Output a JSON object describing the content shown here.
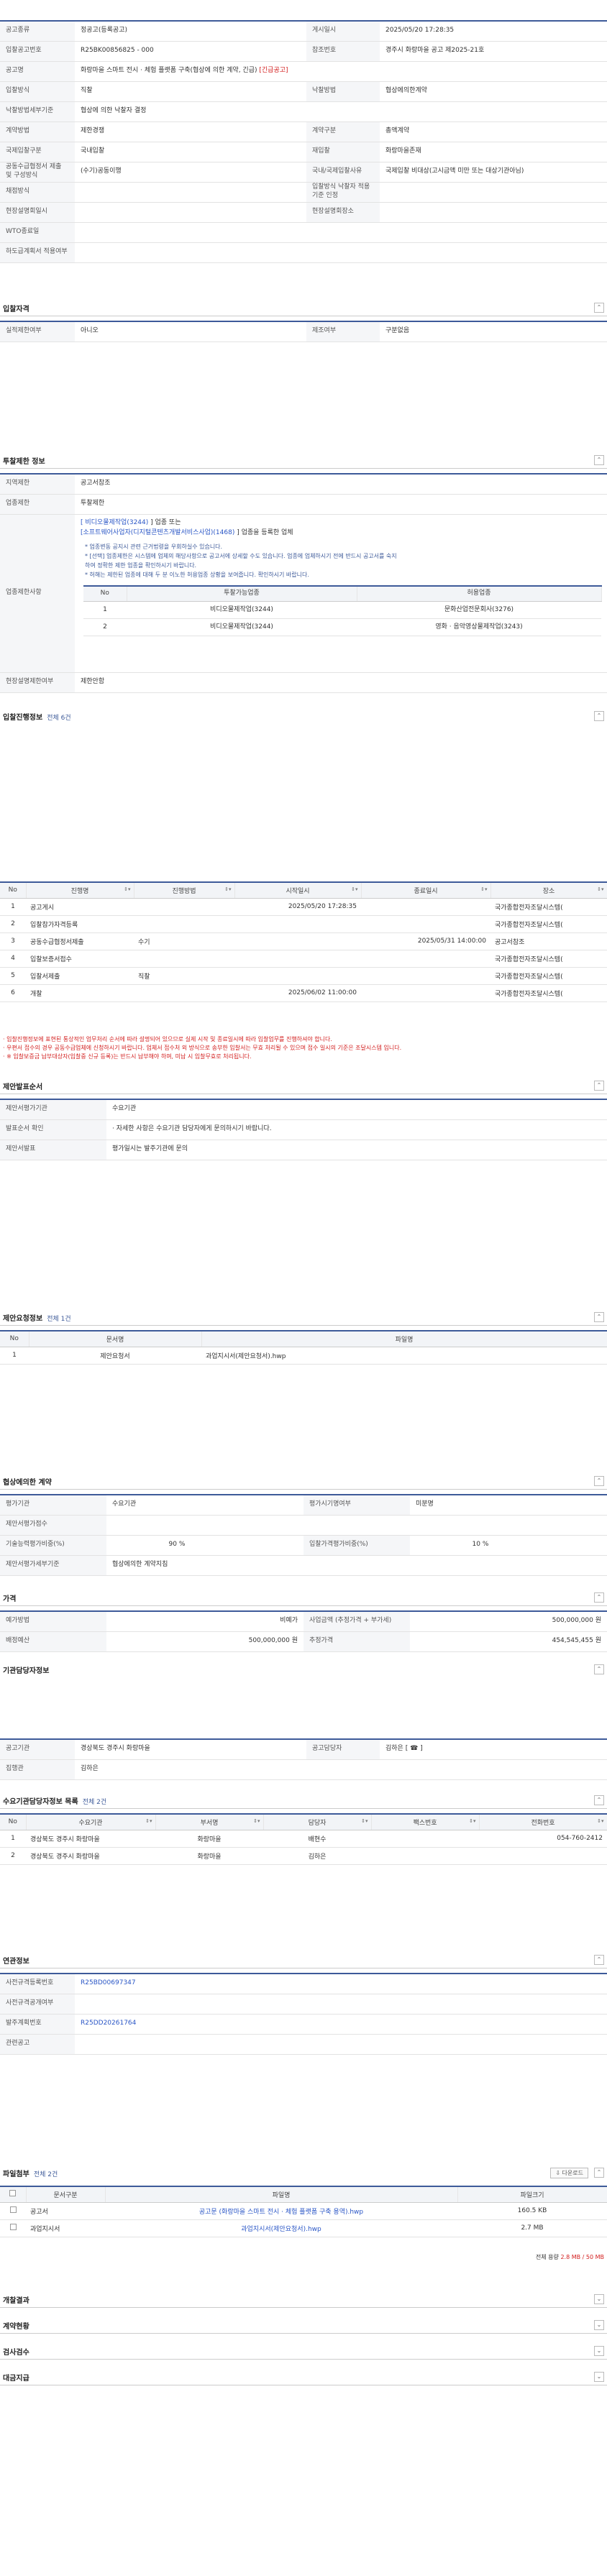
{
  "announcement": {
    "rows": [
      [
        {
          "l": "공고종류",
          "v": "정공고(등록공고)"
        },
        {
          "l": "게시일시",
          "v": "2025/05/20 17:28:35"
        }
      ],
      [
        {
          "l": "입찰공고번호",
          "v": "R25BK00856825 - 000"
        },
        {
          "l": "참조번호",
          "v": "경주시 화랑마을 공고 제2025-21호"
        }
      ],
      [
        {
          "l": "공고명",
          "v": "화랑마을 스마트 전시 · 체험 플랫폼 구축(협상에 의한 계약, 긴급)",
          "badge": "[긴급공고]"
        }
      ],
      [
        {
          "l": "입찰방식",
          "v": "직찰"
        },
        {
          "l": "낙찰방법",
          "v": "협상에의한계약"
        }
      ],
      [
        {
          "l": "낙찰방법세부기준",
          "v": "협상에 의한 낙찰자 결정"
        }
      ],
      [
        {
          "l": "계약방법",
          "v": "제한경쟁"
        },
        {
          "l": "계약구분",
          "v": "총액계약"
        }
      ],
      [
        {
          "l": "국제입찰구분",
          "v": "국내입찰"
        },
        {
          "l": "재입찰",
          "v": "화랑마을존재"
        }
      ],
      [
        {
          "l": "공동수급협정서 제출 및 구성방식",
          "v": "(수기)공동이행"
        },
        {
          "l": "국내/국제입찰사유",
          "v": "국제입찰 비대상(고시금액 미만 또는 대상기관아님)"
        }
      ],
      [
        {
          "l": "채점방식",
          "v": ""
        },
        {
          "l": "입찰방식 낙찰자 적용기준 인정",
          "v": ""
        }
      ],
      [
        {
          "l": "현장설명회일시",
          "v": ""
        },
        {
          "l": "현장설명회장소",
          "v": ""
        }
      ],
      [
        {
          "l": "WTO종료일",
          "v": ""
        }
      ],
      [
        {
          "l": "하도급계획서 적용여부",
          "v": ""
        }
      ]
    ]
  },
  "qualification": {
    "title": "입찰자격",
    "rows": [
      [
        {
          "l": "실적제한여부",
          "v": "아니오"
        },
        {
          "l": "제조여부",
          "v": "구분없음"
        }
      ]
    ]
  },
  "restriction": {
    "title": "투찰제한 정보",
    "region_label": "지역제한",
    "region_value": "공고서참조",
    "bid_label": "업종제한",
    "bid_value": "투찰제한",
    "cond_label": "업종제한사항",
    "cond_line1_a": "[ 비디오물제작업(3244)",
    "cond_line1_b": "] 업종 또는",
    "cond_line2_a": "[소프트웨어사업자(디지털콘텐츠개발서비스사업)(1468)",
    "cond_line2_b": "] 업종을 등록한 업체",
    "notes": [
      "* 업종변동 공지시 관련 근거법령을 우회하실수 있습니다.",
      "* [선택] 업종제한은 시스템에 업체의 해당사항으로 공고서에 상세할 수도 있습니다. 업종에 업체하시기 전에 반드시 공고서를 숙지",
      "  하여 정확한 제한 업종을 확인하시기 바랍니다.",
      "* 허해는 제한된 업종에 대해 두 분 이노한 허용업종 상황을 보여줍니다. 확인하시기 바랍니다."
    ],
    "table": {
      "headers": [
        "No",
        "투찰가능업종",
        "허용업종"
      ],
      "rows": [
        [
          "1",
          "비디오물제작업(3244)",
          "문화산업전문회사(3276)"
        ],
        [
          "2",
          "비디오물제작업(3244)",
          "영화 · 음악영상물제작업(3243)"
        ]
      ]
    },
    "perm_label": "현장설명제한여부",
    "perm_value": "제한안함"
  },
  "progress": {
    "title": "입찰진행정보",
    "count": "전체 6건",
    "headers": [
      "No",
      "진행명",
      "진행방법",
      "시작일시",
      "종료일시",
      "장소"
    ],
    "rows": [
      [
        "1",
        "공고게시",
        "",
        "2025/05/20 17:28:35",
        "",
        "국가종합전자조달시스템("
      ],
      [
        "2",
        "입찰참가자격등록",
        "",
        "",
        "",
        "국가종합전자조달시스템("
      ],
      [
        "3",
        "공동수급협정서제출",
        "수기",
        "",
        "2025/05/31 14:00:00",
        "공고서참조"
      ],
      [
        "4",
        "입찰보증서접수",
        "",
        "",
        "",
        "국가종합전자조달시스템("
      ],
      [
        "5",
        "입찰서제출",
        "직찰",
        "",
        "",
        "국가종합전자조달시스템("
      ],
      [
        "6",
        "개찰",
        "",
        "2025/06/02 11:00:00",
        "",
        "국가종합전자조달시스템("
      ]
    ],
    "notes": [
      "· 입찰진행정보에 표현된 통상적인 업무처리 순서에 따라 설명되어 있으므로 실제 시작 및 종료일시에 따라 입찰업무를 진행하셔야 합니다.",
      "· 우편서 접수의 경우 공동수급업체에 신청하시기 바랍니다. 업체서 접수처 외 방식으로 송부한 입찰서는 무효 처리될 수 있으며 접수 일시의 기준은 조달시스템 입니다.",
      "· ※ 입찰보증금 납부대상자(입찰중 신규 등록)는 반드시 납부해야 하며, 미납 시 입찰무효로 처리됩니다."
    ]
  },
  "proposal": {
    "title": "제안발표순서",
    "rows": [
      [
        {
          "l": "제안서평가기관",
          "v": "수요기관"
        }
      ],
      [
        {
          "l": "발표순서 확인",
          "v": "· 자세한 사항은 수요기관 담당자에게 문의하시기 바랍니다."
        }
      ],
      [
        {
          "l": "제안서발표",
          "v": "평가일시는 발주기관에 문의"
        }
      ]
    ]
  },
  "docs_req": {
    "title": "제안요청정보",
    "count": "전체 1건",
    "headers": [
      "No",
      "문서명",
      "파일명"
    ],
    "rows": [
      [
        "1",
        "제안요청서",
        "과업지시서(제안요청서).hwp"
      ]
    ]
  },
  "negotiation": {
    "title": "협상에의한 계약",
    "rows": [
      [
        {
          "l": "평가기관",
          "v": "수요기관"
        },
        {
          "l": "평가시기명여부",
          "v": "미분명"
        }
      ],
      [
        {
          "l": "제안서평가점수",
          "v": ""
        }
      ],
      [
        {
          "l": "기술능력평가비중(%)",
          "v": "90",
          "unit": "%"
        },
        {
          "l": "입찰가격평가비중(%)",
          "v": "10",
          "unit": "%"
        }
      ],
      [
        {
          "l": "제안서평가세부기준",
          "v": "협상에의한 계약지침"
        }
      ]
    ]
  },
  "price": {
    "title": "가격",
    "rows": [
      [
        {
          "l": "예가방법",
          "v": "비예가"
        },
        {
          "l": "사업금액 (추정가격 + 부가세)",
          "v": "500,000,000 원"
        }
      ],
      [
        {
          "l": "배정예산",
          "v": "500,000,000 원"
        },
        {
          "l": "추정가격",
          "v": "454,545,455 원"
        }
      ]
    ]
  },
  "contact": {
    "title": "기관담당자정보",
    "rows": [
      [
        {
          "l": "공고기관",
          "v": "경상북도 경주시 화랑마을"
        },
        {
          "l": "공고담당자",
          "v": "김하은 [ ☎ ]"
        }
      ],
      [
        {
          "l": "집행관",
          "v": "김하은"
        }
      ]
    ]
  },
  "demand": {
    "title": "수요기관담당자정보 목록",
    "count": "전체 2건",
    "headers": [
      "No",
      "수요기관",
      "부서명",
      "담당자",
      "팩스번호",
      "전화번호"
    ],
    "rows": [
      [
        "1",
        "경상북도 경주시 화랑마을",
        "화랑마을",
        "배현수",
        "",
        "054-760-2412"
      ],
      [
        "2",
        "경상북도 경주시 화랑마을",
        "화랑마을",
        "김하은",
        "",
        ""
      ]
    ]
  },
  "related": {
    "title": "연관정보",
    "rows": [
      [
        {
          "l": "사전규격등록번호",
          "v": "R25BD00697347"
        }
      ],
      [
        {
          "l": "사전규격공개여부",
          "v": ""
        }
      ],
      [
        {
          "l": "발주계획번호",
          "v": "R25DD20261764"
        }
      ],
      [
        {
          "l": "관련공고",
          "v": ""
        }
      ]
    ]
  },
  "files": {
    "title": "파일첨부",
    "count": "전체 2건",
    "download": "⇩ 다운로드",
    "headers": [
      "",
      "문서구분",
      "파일명",
      "파일크기"
    ],
    "rows": [
      [
        "",
        "공고서",
        "공고문 (화랑마을 스마트 전시 · 체험 플랫폼 구축 용역).hwp",
        "160.5 KB"
      ],
      [
        "",
        "과업지시서",
        "과업지시서(제안요청서).hwp",
        "2.7 MB"
      ]
    ],
    "total_label": "전체 용량",
    "total_value": "2.8 MB / 50 MB"
  },
  "footer_sections": [
    "개찰결과",
    "계약현황",
    "검사검수",
    "대금지급"
  ]
}
